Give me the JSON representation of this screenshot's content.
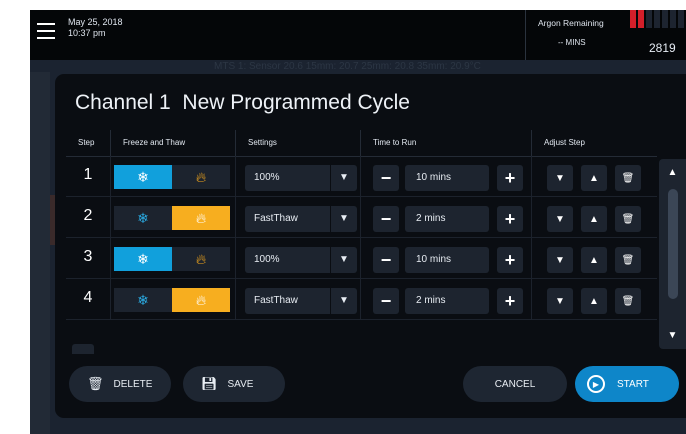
{
  "status": {
    "date": "May 25, 2018",
    "time": "10:37 pm",
    "argon_label": "Argon Remaining",
    "argon_value": "-- MINS",
    "pressure": "2819",
    "meter_color": "#d41f2a"
  },
  "background_readout": "MTS 1: Sensor 20.6  15mm: 20.7  25mm: 20.8  35mm: 20.9°C",
  "modal": {
    "channel": "Channel 1",
    "title": "New Programmed Cycle",
    "columns": [
      "Step",
      "Freeze and Thaw",
      "Settings",
      "Time to Run",
      "Adjust Step"
    ],
    "rows": [
      {
        "step": "1",
        "mode": "freeze",
        "setting": "100%",
        "time": "10 mins"
      },
      {
        "step": "2",
        "mode": "thaw",
        "setting": "FastThaw",
        "time": "2 mins"
      },
      {
        "step": "3",
        "mode": "freeze",
        "setting": "100%",
        "time": "10 mins"
      },
      {
        "step": "4",
        "mode": "thaw",
        "setting": "FastThaw",
        "time": "2 mins"
      }
    ],
    "buttons": {
      "delete": "DELETE",
      "save": "SAVE",
      "cancel": "CANCEL",
      "start": "START"
    }
  },
  "icons": {
    "freeze": "snowflake-icon",
    "thaw": "flame-icon",
    "trash": "trash-icon",
    "save": "floppy-disk-icon",
    "start": "play-circle-icon"
  },
  "colors": {
    "freeze_active": "#11a0dc",
    "thaw_active": "#f7ae1f",
    "start_button": "#0e86c9"
  }
}
